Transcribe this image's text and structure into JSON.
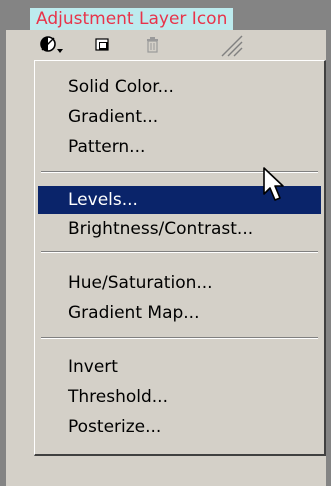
{
  "callout": {
    "label": "Adjustment Layer Icon"
  },
  "toolbar": {
    "buttons": [
      {
        "icon": "adjustment-layer-icon"
      },
      {
        "icon": "new-layer-icon"
      },
      {
        "icon": "trash-icon"
      },
      {
        "icon": "resize-grip-icon"
      }
    ]
  },
  "menu": {
    "items": [
      {
        "label": "Solid Color..."
      },
      {
        "label": "Gradient..."
      },
      {
        "label": "Pattern..."
      },
      {
        "label": "Levels..."
      },
      {
        "label": "Brightness/Contrast..."
      },
      {
        "label": "Hue/Saturation..."
      },
      {
        "label": "Gradient Map..."
      },
      {
        "label": "Invert"
      },
      {
        "label": "Threshold..."
      },
      {
        "label": "Posterize..."
      }
    ],
    "selected": "Levels..."
  },
  "colors": {
    "menu_bg": "#d4d0c8",
    "highlight": "#0a246a",
    "callout_bg": "#bdebee",
    "callout_text": "#e8344a"
  }
}
